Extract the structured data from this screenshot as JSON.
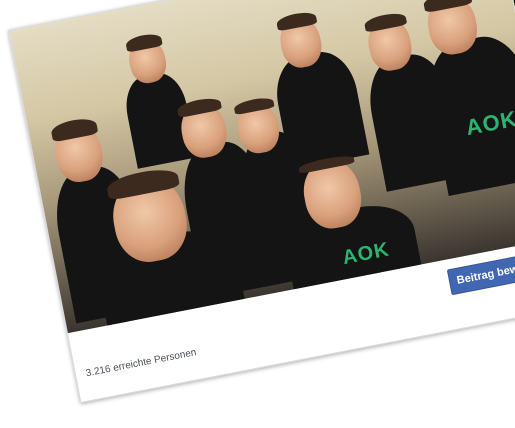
{
  "post": {
    "boost_button_label": "Beitrag bewerben",
    "reach_text": "3.216 erreichte Personen",
    "shirt_logo_text": "AOK",
    "photo_subject": ""
  },
  "colors": {
    "facebook_blue": "#4267b2",
    "aok_green": "#2bb573",
    "logo_black": "#050505"
  },
  "icons": {
    "facebook_logo": "facebook-logo-icon"
  }
}
